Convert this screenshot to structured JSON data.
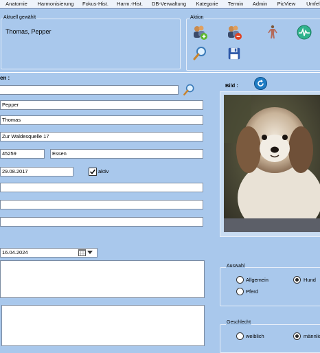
{
  "tabs": [
    "Anatomie",
    "Harmonisierung",
    "Fokus-Hist.",
    "Harm.-Hist.",
    "DB-Verwaltung",
    "Kategorie",
    "Termin",
    "Admin",
    "PicView",
    "Umfeld"
  ],
  "current": {
    "title": "Aktuell gewählt",
    "value": "Thomas, Pepper"
  },
  "action": {
    "title": "Aktion"
  },
  "form": {
    "section_label": "en :",
    "search_value": "",
    "name": "Pepper",
    "owner": "Thomas",
    "street": "Zur Waldesquelle 17",
    "zip": "45259",
    "city": "Essen",
    "date": "29.08.2017",
    "active_label": "aktiv",
    "active_checked": true,
    "field_a": "",
    "field_b": "",
    "field_c": "",
    "date2": "16.04.2024"
  },
  "image": {
    "label": "Bild :"
  },
  "auswahl": {
    "title": "Auswahl",
    "options": [
      {
        "label": "Allgemein",
        "selected": false
      },
      {
        "label": "Hund",
        "selected": true
      },
      {
        "label": "Pferd",
        "selected": false
      }
    ]
  },
  "geschlecht": {
    "title": "Geschlecht",
    "options": [
      {
        "label": "weiblich",
        "selected": false
      },
      {
        "label": "männlich",
        "selected": true
      }
    ]
  },
  "icons": [
    "add-user-icon",
    "remove-user-icon",
    "anatomy-figure-icon",
    "pulse-monitor-icon",
    "search-icon",
    "save-disk-icon",
    "refresh-icon"
  ]
}
